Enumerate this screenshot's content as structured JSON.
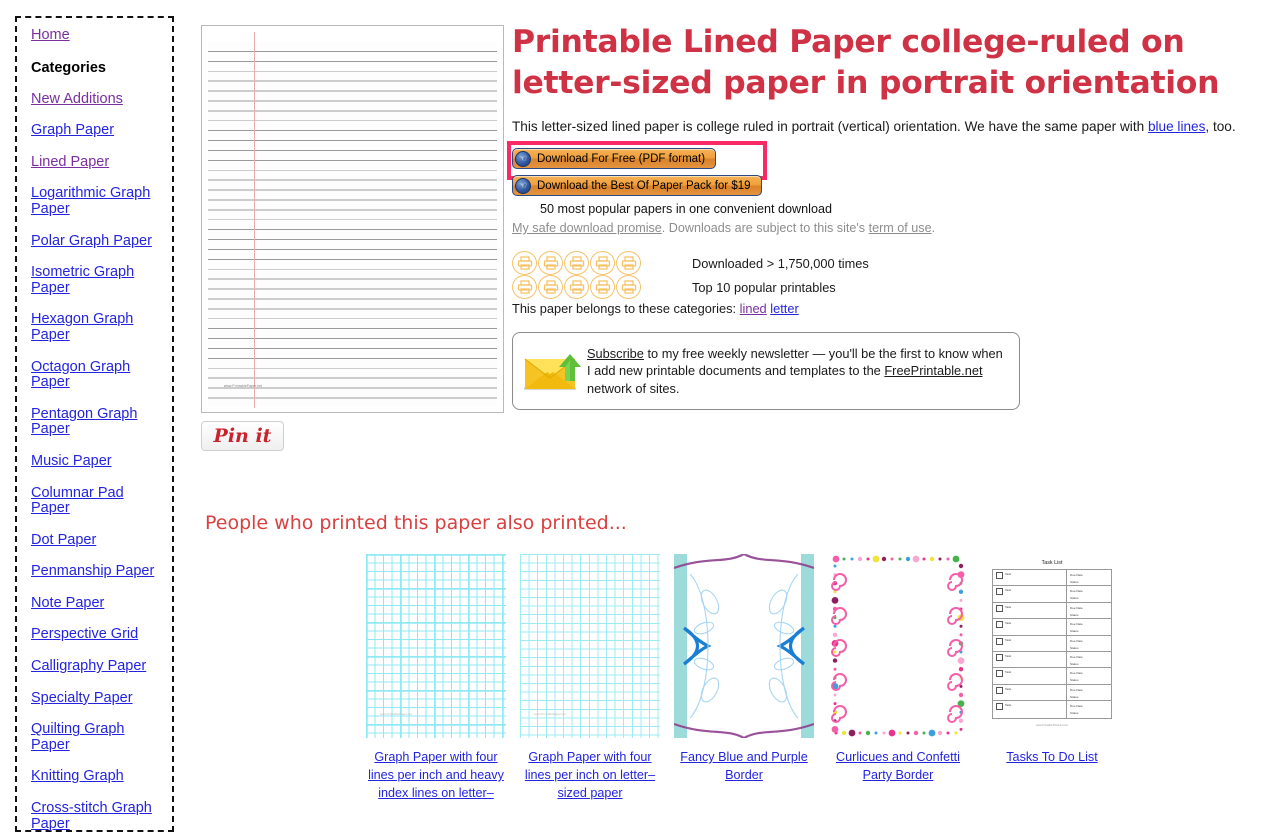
{
  "sidebar": {
    "items": [
      {
        "label": "Home",
        "type": "link",
        "state": "visited"
      },
      {
        "label": "Categories",
        "type": "heading",
        "state": "none"
      },
      {
        "label": "New Additions",
        "type": "link",
        "state": "visited"
      },
      {
        "label": "Graph Paper",
        "type": "link",
        "state": "new"
      },
      {
        "label": "Lined Paper",
        "type": "link",
        "state": "visited"
      },
      {
        "label": "Logarithmic Graph Paper",
        "type": "link",
        "state": "new"
      },
      {
        "label": "Polar Graph Paper",
        "type": "link",
        "state": "new"
      },
      {
        "label": "Isometric Graph Paper",
        "type": "link",
        "state": "new"
      },
      {
        "label": "Hexagon Graph Paper",
        "type": "link",
        "state": "new"
      },
      {
        "label": "Octagon Graph Paper",
        "type": "link",
        "state": "new"
      },
      {
        "label": "Pentagon Graph Paper",
        "type": "link",
        "state": "new"
      },
      {
        "label": "Music Paper",
        "type": "link",
        "state": "new"
      },
      {
        "label": "Columnar Pad Paper",
        "type": "link",
        "state": "new"
      },
      {
        "label": "Dot Paper",
        "type": "link",
        "state": "new"
      },
      {
        "label": "Penmanship Paper",
        "type": "link",
        "state": "new"
      },
      {
        "label": "Note Paper",
        "type": "link",
        "state": "new"
      },
      {
        "label": "Perspective Grid",
        "type": "link",
        "state": "new"
      },
      {
        "label": "Calligraphy Paper",
        "type": "link",
        "state": "new"
      },
      {
        "label": "Specialty Paper",
        "type": "link",
        "state": "new"
      },
      {
        "label": "Quilting Graph Paper",
        "type": "link",
        "state": "new"
      },
      {
        "label": "Knitting Graph",
        "type": "link",
        "state": "new"
      },
      {
        "label": "Cross-stitch Graph Paper",
        "type": "link",
        "state": "new"
      }
    ]
  },
  "preview": {
    "credit": "www.PrintablePaper.net",
    "pin_it_label": "Pin it"
  },
  "main": {
    "title": "Printable Lined Paper college-ruled on letter-sized paper in portrait orientation",
    "description_part1": "This letter-sized lined paper is college ruled in portrait (vertical) orientation. We have the same paper with ",
    "description_link": "blue lines",
    "description_part2": ", too.",
    "download_free_label": "Download For Free (PDF format)",
    "download_pack_label": "Download the Best Of Paper Pack for $19",
    "pack_note": "50 most popular papers in one convenient download",
    "promise_link": "My safe download promise",
    "promise_mid": ". Downloads are subject to this site's ",
    "promise_terms": "term of use",
    "promise_end": ".",
    "stat_downloads": "Downloaded > 1,750,000 times",
    "stat_rank": "Top 10 popular printables",
    "categories_prefix": "This paper belongs to these categories: ",
    "category_links": [
      "lined",
      "letter"
    ],
    "subscribe_link": "Subscribe",
    "subscribe_text1": " to my free weekly newsletter — you'll be the first to know when I add new printable documents and templates to the ",
    "subscribe_site": "FreePrintable.net",
    "subscribe_text2": " network of sites."
  },
  "related": {
    "heading": "People who printed this paper also printed...",
    "items": [
      {
        "caption": "Graph Paper with four lines per inch and heavy index lines on letter–",
        "thumb": "graph-heavy"
      },
      {
        "caption": "Graph Paper with four lines per inch on letter–sized paper",
        "thumb": "graph-plain"
      },
      {
        "caption": "Fancy Blue and Purple Border",
        "thumb": "blue-purple-border"
      },
      {
        "caption": "Curlicues and Confetti Party Border",
        "thumb": "confetti-border"
      },
      {
        "caption": "Tasks To Do List",
        "thumb": "task-list"
      }
    ]
  },
  "task_thumb": {
    "title": "Task List",
    "task_label": "Task",
    "due_label": "Due Date",
    "status_label": "Status",
    "credit": "www.PrintableToDoList.com",
    "row_count": 9
  },
  "colors": {
    "title_red": "#cf3244",
    "link_blue": "#2424e0",
    "link_visited": "#7b2fa0",
    "highlight_pink": "#fa2a66",
    "button_orange": "#e59440",
    "badge_orange": "#f5c268",
    "related_heading_red": "#d94040"
  },
  "icons": {
    "download": "hand-cursor-icon",
    "badge": "printer-icon",
    "subscribe": "envelope-upload-icon"
  }
}
